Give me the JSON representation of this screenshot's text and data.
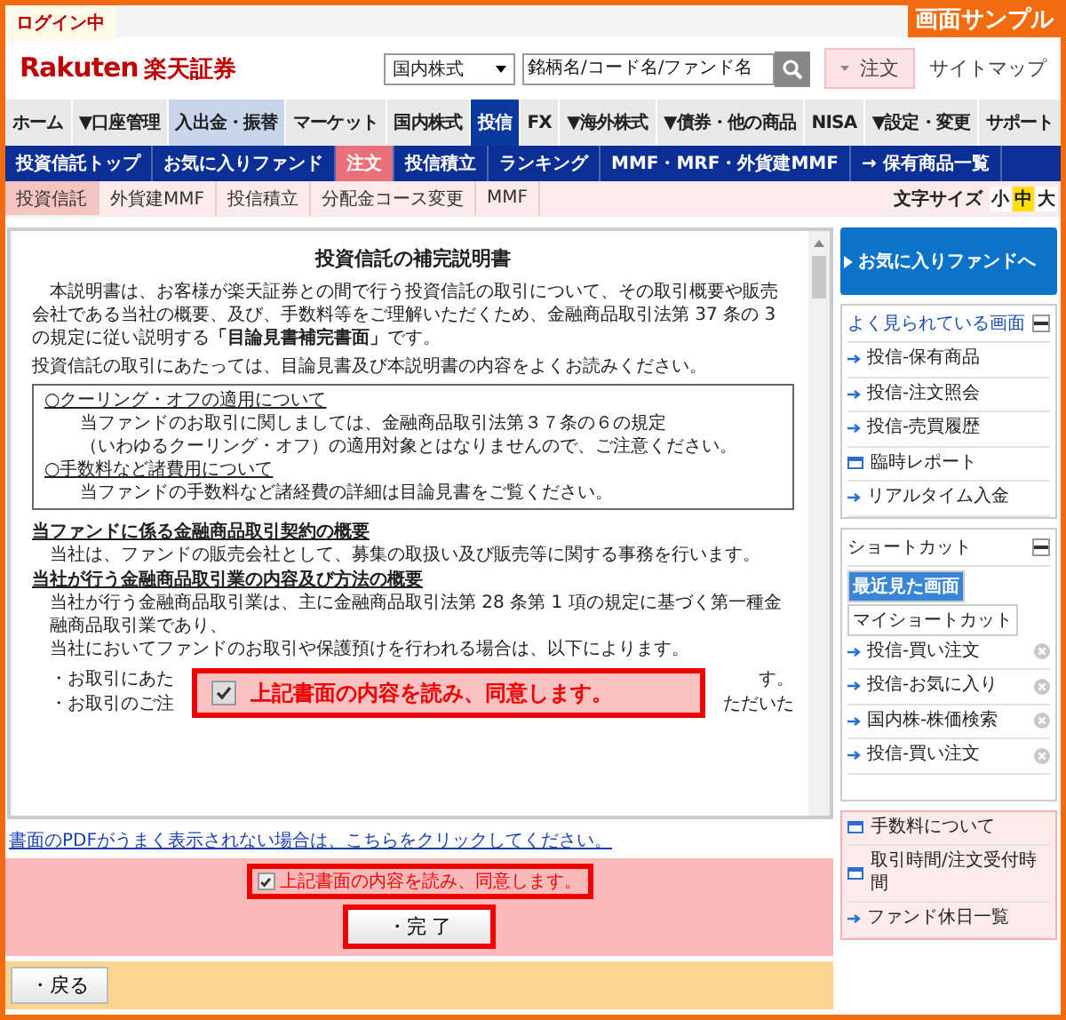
{
  "top_bar": {
    "status": "ログイン中",
    "badge": "画面サンプル"
  },
  "header": {
    "logo_latin": "Rakuten",
    "logo_kanji": "楽天証券",
    "market_select": "国内株式",
    "search_placeholder": "銘柄名/コード名/ファンド名",
    "order_button": "注文",
    "sitemap_link": "サイトマップ"
  },
  "main_nav": [
    {
      "label": "ホーム",
      "selected": false,
      "hovered": false
    },
    {
      "label": "▼口座管理",
      "selected": false,
      "hovered": false
    },
    {
      "label": "入出金・振替",
      "selected": false,
      "hovered": true
    },
    {
      "label": "マーケット",
      "selected": false,
      "hovered": false
    },
    {
      "label": "国内株式",
      "selected": false,
      "hovered": false
    },
    {
      "label": "投信",
      "selected": true,
      "hovered": false
    },
    {
      "label": "FX",
      "selected": false,
      "hovered": false
    },
    {
      "label": "▼海外株式",
      "selected": false,
      "hovered": false
    },
    {
      "label": "▼債券・他の商品",
      "selected": false,
      "hovered": false
    },
    {
      "label": "NISA",
      "selected": false,
      "hovered": false
    },
    {
      "label": "▼設定・変更",
      "selected": false,
      "hovered": false
    },
    {
      "label": "サポート",
      "selected": false,
      "hovered": false
    }
  ],
  "sub_nav": [
    {
      "label": "投資信託トップ",
      "selected": false
    },
    {
      "label": "お気に入りファンド",
      "selected": false
    },
    {
      "label": "注文",
      "selected": true
    },
    {
      "label": "投信積立",
      "selected": false
    },
    {
      "label": "ランキング",
      "selected": false
    },
    {
      "label": "MMF・MRF・外貨建MMF",
      "selected": false
    },
    {
      "label": "→ 保有商品一覧",
      "selected": false
    }
  ],
  "tertiary_nav": [
    {
      "label": "投資信託",
      "selected": true
    },
    {
      "label": "外貨建MMF",
      "selected": false
    },
    {
      "label": "投信積立",
      "selected": false
    },
    {
      "label": "分配金コース変更",
      "selected": false
    },
    {
      "label": "MMF",
      "selected": false
    }
  ],
  "text_size": {
    "label": "文字サイズ",
    "options": [
      {
        "label": "小",
        "selected": false
      },
      {
        "label": "中",
        "selected": true
      },
      {
        "label": "大",
        "selected": false
      }
    ]
  },
  "document": {
    "title": "投資信託の補完説明書",
    "intro": "本説明書は、お客様が楽天証券との間で行う投資信託の取引について、その取引概要や販売会社である当社の概要、及び、手数料等をご理解いただくため、金融商品取引法第 37 条の 3 の規定に従い説明する**「目論見書補完書面」**です。",
    "note": "投資信託の取引にあたっては、目論見書及び本説明書の内容をよくお読みください。",
    "box_sections": [
      {
        "heading": "○クーリング・オフの適用について",
        "lines": [
          "当ファンドのお取引に関しましては、金融商品取引法第３７条の６の規定",
          "（いわゆるクーリング・オフ）の適用対象とはなりませんので、ご注意ください。"
        ]
      },
      {
        "heading": "○手数料など諸費用について",
        "lines": [
          "当ファンドの手数料など諸経費の詳細は目論見書をご覧ください。"
        ]
      }
    ],
    "sections": [
      {
        "heading": "当ファンドに係る金融商品取引契約の概要",
        "lines": [
          "当社は、ファンドの販売会社として、募集の取扱い及び販売等に関する事務を行います。"
        ]
      },
      {
        "heading": "当社が行う金融商品取引業の内容及び方法の概要",
        "lines": [
          "当社が行う金融商品取引業は、主に金融商品取引法第 28 条第 1 項の規定に基づく第一種金融商品取引業であり、",
          "当社においてファンドのお取引や保護預けを行われる場合は、以下によります。"
        ]
      }
    ],
    "covered_lines": [
      {
        "left": "・お取引にあた",
        "right": "す。"
      },
      {
        "left": "・お取引のご注",
        "right": "ただいた"
      }
    ]
  },
  "callout": {
    "label": "上記書面の内容を読み、同意します。",
    "checked": true
  },
  "pdf_link": "書面のPDFがうまく表示されない場合は、こちらをクリックしてください。",
  "agreement": {
    "label": "上記書面の内容を読み、同意します。",
    "checked": true
  },
  "complete_button": "・完 了",
  "back_button": "・戻る",
  "sidebar": {
    "favorites_button": "お気に入りファンドへ",
    "popular": {
      "title": "よく見られている画面",
      "items": [
        {
          "label": "投信-保有商品",
          "kind": "arrow"
        },
        {
          "label": "投信-注文照会",
          "kind": "arrow"
        },
        {
          "label": "投信-売買履歴",
          "kind": "arrow"
        },
        {
          "label": "臨時レポート",
          "kind": "window"
        },
        {
          "label": "リアルタイム入金",
          "kind": "arrow"
        }
      ]
    },
    "shortcut": {
      "title": "ショートカット",
      "tabs": [
        {
          "label": "最近見た画面",
          "selected": true
        },
        {
          "label": "マイショートカット",
          "selected": false
        }
      ],
      "items": [
        "投信-買い注文",
        "投信-お気に入り",
        "国内株-株価検索",
        "投信-買い注文"
      ]
    },
    "links": [
      {
        "label": "手数料について",
        "kind": "window"
      },
      {
        "label": "取引時間/注文受付時間",
        "kind": "window"
      },
      {
        "label": "ファンド休日一覧",
        "kind": "arrow"
      }
    ]
  }
}
